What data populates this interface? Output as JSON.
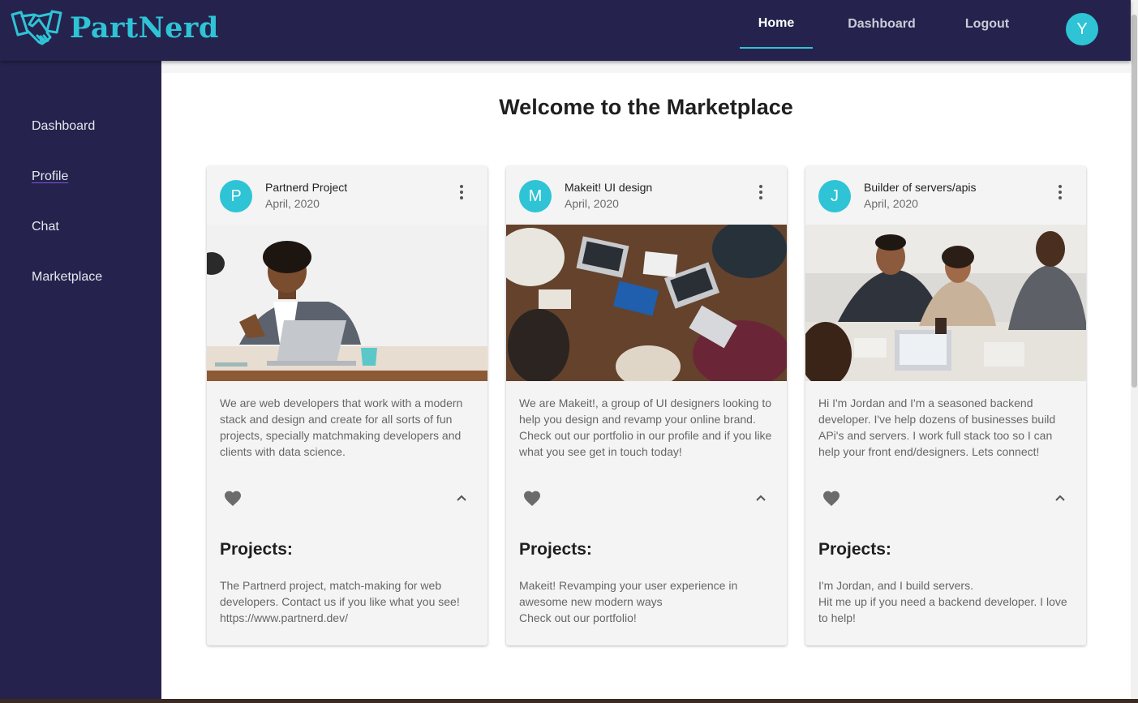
{
  "brand": {
    "name": "PartNerd",
    "logo_icon": "handshake-icon"
  },
  "nav": {
    "tabs": [
      {
        "label": "Home"
      },
      {
        "label": "Dashboard"
      },
      {
        "label": "Logout"
      }
    ],
    "avatar_letter": "Y"
  },
  "sidebar": {
    "items": [
      {
        "label": "Dashboard"
      },
      {
        "label": "Profile"
      },
      {
        "label": "Chat"
      },
      {
        "label": "Marketplace"
      }
    ]
  },
  "main": {
    "title": "Welcome to the Marketplace"
  },
  "cards": [
    {
      "avatar": "P",
      "title": "Partnerd Project",
      "date": "April, 2020",
      "image": "man-at-laptop-handshake-photo",
      "description": "We are web developers that work with a modern stack and design and create for all sorts of fun projects, specially matchmaking developers and clients with data science.",
      "projects_heading": "Projects:",
      "projects_text": "The Partnerd project, match-making for web developers. Contact us if you like what you see! https://www.partnerd.dev/"
    },
    {
      "avatar": "M",
      "title": "Makeit! UI design",
      "date": "April, 2020",
      "image": "team-laptops-table-photo",
      "description": "We are Makeit!, a group of UI designers looking to help you design and revamp your online brand. Check out our portfolio in our profile and if you like what you see get in touch today!",
      "projects_heading": "Projects:",
      "projects_text": "Makeit! Revamping your user experience in awesome new modern ways\nCheck out our portfolio!"
    },
    {
      "avatar": "J",
      "title": "Builder of servers/apis",
      "date": "April, 2020",
      "image": "team-meeting-photo",
      "description": "Hi I'm Jordan and I'm a seasoned backend developer. I've help dozens of businesses build APi's and servers. I work full stack too so I can help your front end/designers. Lets connect!",
      "projects_heading": "Projects:",
      "projects_text": "I'm Jordan, and I build servers.\nHit me up if you need a backend developer. I love to help!"
    }
  ],
  "colors": {
    "appbar": "#25234d",
    "accent": "#2ec4d6",
    "card_bg": "#f4f4f4"
  }
}
